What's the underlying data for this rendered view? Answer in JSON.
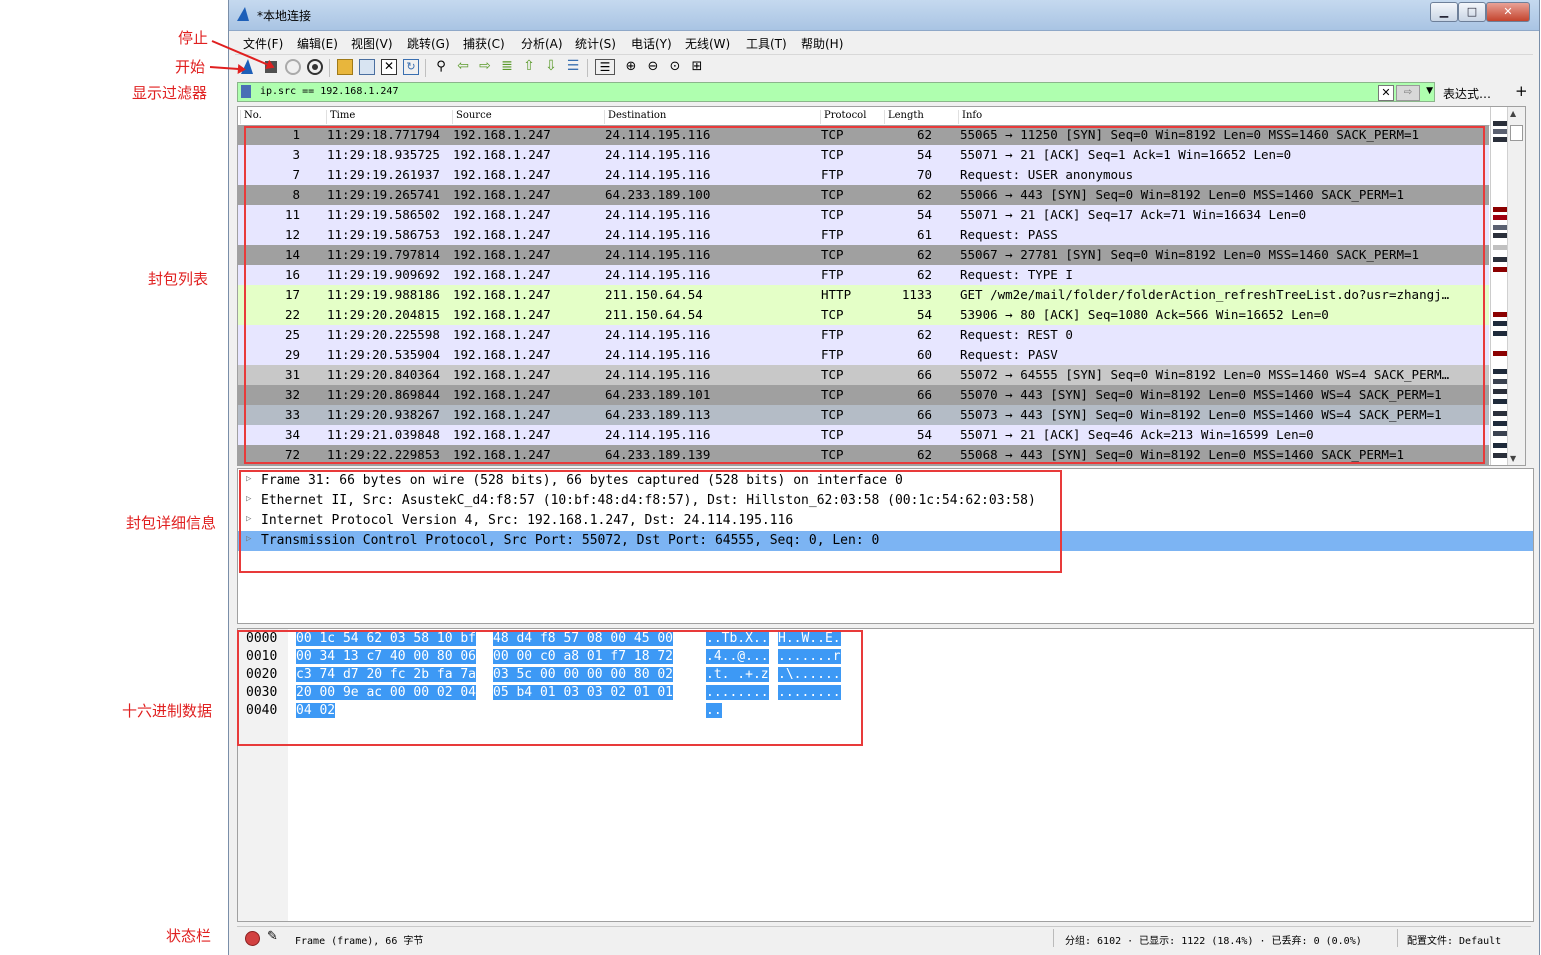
{
  "annotations": {
    "stop": "停止",
    "start": "开始",
    "display_filter": "显示过滤器",
    "packet_list": "封包列表",
    "packet_details": "封包详细信息",
    "hex_data": "十六进制数据",
    "status_bar": "状态栏"
  },
  "window": {
    "title": "*本地连接"
  },
  "menu": [
    "文件(F)",
    "编辑(E)",
    "视图(V)",
    "跳转(G)",
    "捕获(C)",
    "分析(A)",
    "统计(S)",
    "电话(Y)",
    "无线(W)",
    "工具(T)",
    "帮助(H)"
  ],
  "filter": {
    "value": "ip.src == 192.168.1.247",
    "expression_label": "表达式…",
    "plus": "+",
    "clear": "✕",
    "apply": "⇨",
    "dropdown": "▼"
  },
  "packet_list": {
    "headers": [
      "No.",
      "Time",
      "Source",
      "Destination",
      "Protocol",
      "Length",
      "Info"
    ],
    "rows": [
      {
        "no": "1",
        "time": "11:29:18.771794",
        "src": "192.168.1.247",
        "dst": "24.114.195.116",
        "proto": "TCP",
        "len": "62",
        "info": "55065 → 11250 [SYN] Seq=0 Win=8192 Len=0 MSS=1460 SACK_PERM=1",
        "bg": "#a0a0a0"
      },
      {
        "no": "3",
        "time": "11:29:18.935725",
        "src": "192.168.1.247",
        "dst": "24.114.195.116",
        "proto": "TCP",
        "len": "54",
        "info": "55071 → 21 [ACK] Seq=1 Ack=1 Win=16652 Len=0",
        "bg": "#e7e6ff"
      },
      {
        "no": "7",
        "time": "11:29:19.261937",
        "src": "192.168.1.247",
        "dst": "24.114.195.116",
        "proto": "FTP",
        "len": "70",
        "info": "Request: USER anonymous",
        "bg": "#e7e6ff"
      },
      {
        "no": "8",
        "time": "11:29:19.265741",
        "src": "192.168.1.247",
        "dst": "64.233.189.100",
        "proto": "TCP",
        "len": "62",
        "info": "55066 → 443 [SYN] Seq=0 Win=8192 Len=0 MSS=1460 SACK_PERM=1",
        "bg": "#a0a0a0"
      },
      {
        "no": "11",
        "time": "11:29:19.586502",
        "src": "192.168.1.247",
        "dst": "24.114.195.116",
        "proto": "TCP",
        "len": "54",
        "info": "55071 → 21 [ACK] Seq=17 Ack=71 Win=16634 Len=0",
        "bg": "#e7e6ff"
      },
      {
        "no": "12",
        "time": "11:29:19.586753",
        "src": "192.168.1.247",
        "dst": "24.114.195.116",
        "proto": "FTP",
        "len": "61",
        "info": "Request: PASS",
        "bg": "#e7e6ff"
      },
      {
        "no": "14",
        "time": "11:29:19.797814",
        "src": "192.168.1.247",
        "dst": "24.114.195.116",
        "proto": "TCP",
        "len": "62",
        "info": "55067 → 27781 [SYN] Seq=0 Win=8192 Len=0 MSS=1460 SACK_PERM=1",
        "bg": "#a0a0a0"
      },
      {
        "no": "16",
        "time": "11:29:19.909692",
        "src": "192.168.1.247",
        "dst": "24.114.195.116",
        "proto": "FTP",
        "len": "62",
        "info": "Request: TYPE I",
        "bg": "#e7e6ff"
      },
      {
        "no": "17",
        "time": "11:29:19.988186",
        "src": "192.168.1.247",
        "dst": "211.150.64.54",
        "proto": "HTTP",
        "len": "1133",
        "info": "GET /wm2e/mail/folder/folderAction_refreshTreeList.do?usr=zhangj…",
        "bg": "#e4ffc7"
      },
      {
        "no": "22",
        "time": "11:29:20.204815",
        "src": "192.168.1.247",
        "dst": "211.150.64.54",
        "proto": "TCP",
        "len": "54",
        "info": "53906 → 80 [ACK] Seq=1080 Ack=566 Win=16652 Len=0",
        "bg": "#e4ffc7"
      },
      {
        "no": "25",
        "time": "11:29:20.225598",
        "src": "192.168.1.247",
        "dst": "24.114.195.116",
        "proto": "FTP",
        "len": "62",
        "info": "Request: REST 0",
        "bg": "#e7e6ff"
      },
      {
        "no": "29",
        "time": "11:29:20.535904",
        "src": "192.168.1.247",
        "dst": "24.114.195.116",
        "proto": "FTP",
        "len": "60",
        "info": "Request: PASV",
        "bg": "#e7e6ff"
      },
      {
        "no": "31",
        "time": "11:29:20.840364",
        "src": "192.168.1.247",
        "dst": "24.114.195.116",
        "proto": "TCP",
        "len": "66",
        "info": "55072 → 64555 [SYN] Seq=0 Win=8192 Len=0 MSS=1460 WS=4 SACK_PERM…",
        "bg": "#c8c8c8"
      },
      {
        "no": "32",
        "time": "11:29:20.869844",
        "src": "192.168.1.247",
        "dst": "64.233.189.101",
        "proto": "TCP",
        "len": "66",
        "info": "55070 → 443 [SYN] Seq=0 Win=8192 Len=0 MSS=1460 WS=4 SACK_PERM=1",
        "bg": "#a0a0a0"
      },
      {
        "no": "33",
        "time": "11:29:20.938267",
        "src": "192.168.1.247",
        "dst": "64.233.189.113",
        "proto": "TCP",
        "len": "66",
        "info": "55073 → 443 [SYN] Seq=0 Win=8192 Len=0 MSS=1460 WS=4 SACK_PERM=1",
        "bg": "#b4bcc6"
      },
      {
        "no": "34",
        "time": "11:29:21.039848",
        "src": "192.168.1.247",
        "dst": "24.114.195.116",
        "proto": "TCP",
        "len": "54",
        "info": "55071 → 21 [ACK] Seq=46 Ack=213 Win=16599 Len=0",
        "bg": "#e7e6ff"
      },
      {
        "no": "72",
        "time": "11:29:22.229853",
        "src": "192.168.1.247",
        "dst": "64.233.189.139",
        "proto": "TCP",
        "len": "62",
        "info": "55068 → 443 [SYN] Seq=0 Win=8192 Len=0 MSS=1460 SACK_PERM=1",
        "bg": "#a0a0a0"
      }
    ]
  },
  "details": [
    "Frame 31: 66 bytes on wire (528 bits), 66 bytes captured (528 bits) on interface 0",
    "Ethernet II, Src: AsustekC_d4:f8:57 (10:bf:48:d4:f8:57), Dst: Hillston_62:03:58 (00:1c:54:62:03:58)",
    "Internet Protocol Version 4, Src: 192.168.1.247, Dst: 24.114.195.116",
    "Transmission Control Protocol, Src Port: 55072, Dst Port: 64555, Seq: 0, Len: 0"
  ],
  "hex": {
    "offsets": [
      "0000",
      "0010",
      "0020",
      "0030",
      "0040"
    ],
    "bytes_a": [
      "00 1c 54 62 03 58 10 bf",
      "00 34 13 c7 40 00 80 06",
      "c3 74 d7 20 fc 2b fa 7a",
      "20 00 9e ac 00 00 02 04",
      "04 02"
    ],
    "bytes_b": [
      "48 d4 f8 57 08 00 45 00",
      "00 00 c0 a8 01 f7 18 72",
      "03 5c 00 00 00 00 80 02",
      "05 b4 01 03 03 02 01 01",
      ""
    ],
    "ascii_a": [
      "..Tb.X..",
      ".4..@...",
      ".t. .+.z",
      "........",
      ".."
    ],
    "ascii_b": [
      "H..W..E.",
      ".......r",
      ".\\......",
      "........",
      ""
    ]
  },
  "status": {
    "frame_info": "Frame (frame), 66 字节",
    "packets": "分组: 6102 · 已显示: 1122 (18.4%) · 已丢弃: 0 (0.0%)",
    "profile": "配置文件: Default"
  },
  "colors": {
    "selection": "#3d99f5",
    "annotation_red": "#e83a3a",
    "filter_ok": "#afffaf"
  }
}
